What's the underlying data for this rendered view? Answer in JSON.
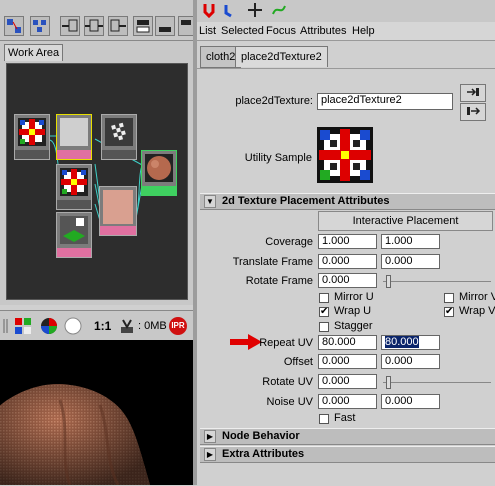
{
  "menu": {
    "items": [
      "List",
      "Selected",
      "Focus",
      "Attributes",
      "Help"
    ]
  },
  "left": {
    "tab_label": "Work Area",
    "viewbar": {
      "ratio": "1:1",
      "memory": ": 0MB",
      "ipr": "IPR"
    }
  },
  "tabs": [
    "cloth2",
    "place2dTexture2"
  ],
  "node": {
    "name_label": "place2dTexture:",
    "name_value": "place2dTexture2",
    "sample_label": "Utility Sample"
  },
  "sections": {
    "placement": "2d Texture Placement Attributes",
    "node_behavior": "Node Behavior",
    "extra": "Extra Attributes"
  },
  "interactive_placement": "Interactive Placement",
  "attrs": {
    "coverage": {
      "label": "Coverage",
      "u": "1.000",
      "v": "1.000"
    },
    "translate_frame": {
      "label": "Translate Frame",
      "u": "0.000",
      "v": "0.000"
    },
    "rotate_frame": {
      "label": "Rotate Frame",
      "value": "0.000"
    },
    "mirror_u": {
      "label": "Mirror U",
      "checked": false
    },
    "mirror_v": {
      "label": "Mirror V",
      "checked": false
    },
    "wrap_u": {
      "label": "Wrap U",
      "checked": true
    },
    "wrap_v": {
      "label": "Wrap V",
      "checked": true
    },
    "stagger": {
      "label": "Stagger",
      "checked": false
    },
    "repeat_uv": {
      "label": "Repeat UV",
      "u": "80.000",
      "v": "80.000"
    },
    "offset": {
      "label": "Offset",
      "u": "0.000",
      "v": "0.000"
    },
    "rotate_uv": {
      "label": "Rotate UV",
      "value": "0.000"
    },
    "noise_uv": {
      "label": "Noise UV",
      "u": "0.000",
      "v": "0.000"
    },
    "fast": {
      "label": "Fast",
      "checked": false
    }
  },
  "colors": {
    "highlight_arrow": "#e00000",
    "selection": "#0a246a",
    "cloth_texture": "#b07055"
  },
  "icons": [
    "go-to-input-icon",
    "go-to-output-icon",
    "ipr-icon",
    "checker-swatch-icon",
    "render-swatch-icon"
  ]
}
